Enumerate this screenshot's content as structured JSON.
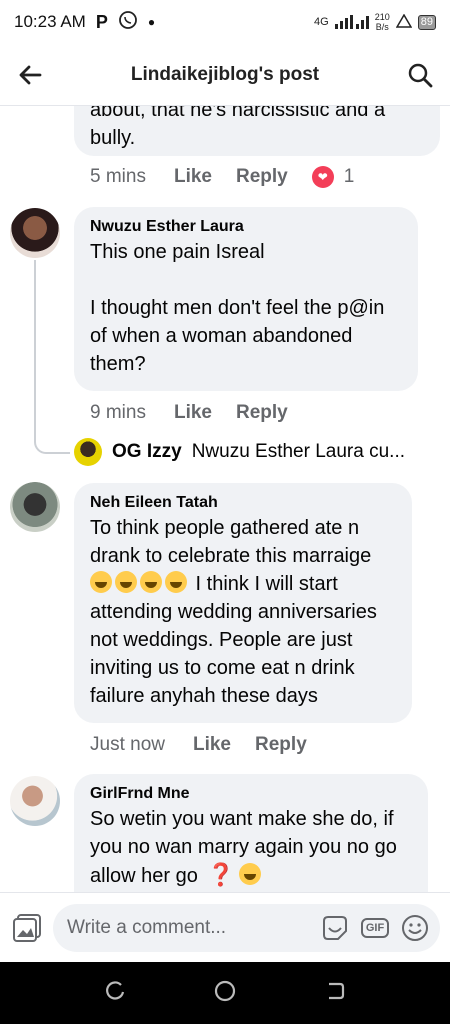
{
  "status": {
    "time": "10:23 AM",
    "p_icon": "P",
    "network": "4G",
    "speed_value": "210",
    "speed_unit": "B/s",
    "battery": "89"
  },
  "header": {
    "title": "Lindaikejiblog's post"
  },
  "comments": [
    {
      "text": "about, that he's narcissistic and a\nbully.",
      "time": "5 mins",
      "like": "Like",
      "reply": "Reply",
      "reaction_count": "1"
    },
    {
      "author": "Nwuzu Esther Laura",
      "text": "This one pain Isreal\n\nI thought men don't feel the p@in\nof when a woman abandoned\nthem?",
      "time": "9 mins",
      "like": "Like",
      "reply": "Reply"
    },
    {
      "author": "Neh Eileen Tatah",
      "text_a": "To think people gathered ate n\ndrank to celebrate this marraige\n",
      "text_b": " I think I will start\nattending wedding anniversaries\nnot weddings. People are just\ninviting us to come eat n drink\nfailure anyhah these days",
      "time": "Just now",
      "like": "Like",
      "reply": "Reply"
    },
    {
      "author": "GirlFrnd Mne",
      "text_a": "So wetin you want make she do, if\nyou no wan marry again you no go\nallow her go ",
      "emoji_q": "❓"
    }
  ],
  "reply_preview": {
    "name": "OG Izzy",
    "text": "Nwuzu Esther Laura cu..."
  },
  "composer": {
    "placeholder": "Write a comment...",
    "gif_label": "GIF"
  },
  "colors": {
    "bubble": "#f0f2f5",
    "meta": "#65676b",
    "heart": "#f33e58"
  }
}
